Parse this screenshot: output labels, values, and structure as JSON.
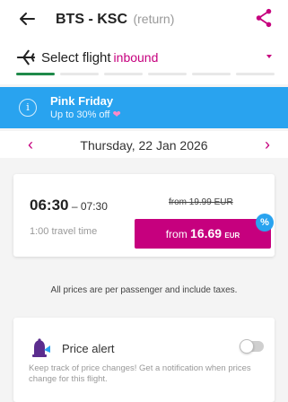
{
  "header": {
    "route": "BTS - KSC",
    "trip_type": "(return)",
    "back_icon": "arrow-left-icon",
    "share_icon": "share-icon"
  },
  "flight_selector": {
    "label": "Select flight",
    "direction": "inbound",
    "plane_icon": "plane-icon",
    "steps_total": 6,
    "steps_active": 1
  },
  "promo": {
    "title": "Pink Friday",
    "subtitle": "Up to 30% off",
    "heart": "❤"
  },
  "date_nav": {
    "prev": "‹",
    "date": "Thursday, 22 Jan 2026",
    "next": "›"
  },
  "flight": {
    "departure": "06:30",
    "separator": "–",
    "arrival": "07:30",
    "duration": "1:00 travel time",
    "old_price": "from 19.99 EUR",
    "price_prefix": "from",
    "price_amount": "16.69",
    "price_currency": "EUR",
    "discount_badge": "%"
  },
  "note": "All prices are per passenger and include taxes.",
  "price_alert": {
    "title": "Price alert",
    "description": "Keep track of price changes! Get a notification when prices change for this flight.",
    "enabled": false
  },
  "colors": {
    "brand": "#c6007e",
    "promo": "#29a3ef",
    "progress": "#1f8a4a"
  }
}
